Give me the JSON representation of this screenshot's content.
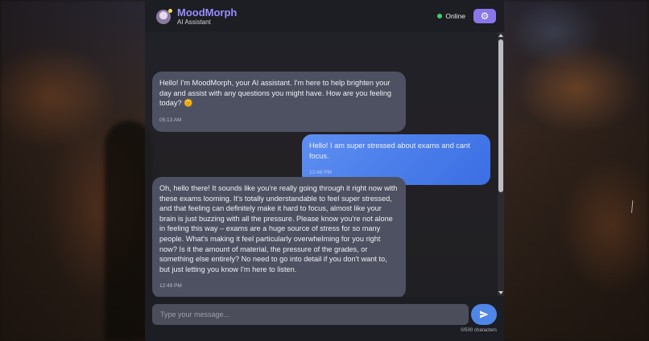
{
  "header": {
    "title": "MoodMorph",
    "subtitle": "AI Assistant",
    "status": "Online",
    "settings_icon": "gear-icon"
  },
  "messages": [
    {
      "sender": "bot",
      "text": "Hello! I'm MoodMorph, your AI assistant. I'm here to help brighten your day and assist with any questions you might have. How are you feeling today? 🌞",
      "time": "05:13 AM"
    },
    {
      "sender": "user",
      "text": "Hello! I am super stressed about exams and cant focus.",
      "time": "12:48 PM"
    },
    {
      "sender": "bot",
      "text": "Oh, hello there! It sounds like you're really going through it right now with these exams looming. It's totally understandable to feel super stressed, and that feeling can definitely make it hard to focus, almost like your brain is just buzzing with all the pressure. Please know you're not alone in feeling this way – exams are a huge source of stress for so many people. What's making it feel particularly overwhelming for you right now? Is it the amount of material, the pressure of the grades, or something else entirely? No need to go into detail if you don't want to, but just letting you know I'm here to listen.",
      "time": "12:49 PM"
    },
    {
      "sender": "bot",
      "type": "image",
      "image_icon": "stressed-person-image"
    }
  ],
  "input": {
    "placeholder": "Type your message...",
    "value": "",
    "char_count": "0/500 characters",
    "send_icon": "paper-plane-icon"
  },
  "colors": {
    "accent": "#8a76ea",
    "title": "#9b8cff",
    "user_bubble": "#4f86e8",
    "bot_bubble": "#4d5161",
    "online": "#3ecf6a"
  }
}
